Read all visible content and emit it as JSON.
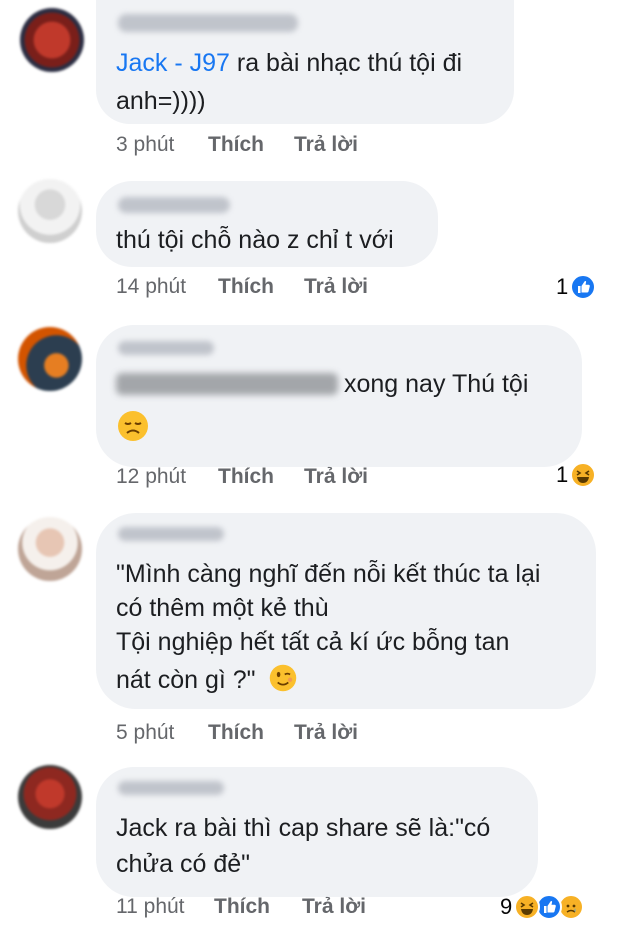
{
  "comments": [
    {
      "mention": "Jack - J97",
      "text_after_mention": " ra bài nhạc thú tội đi",
      "line2": "anh=))))",
      "time": "3 phút",
      "like_label": "Thích",
      "reply_label": "Trả lời"
    },
    {
      "text": "thú tội chỗ nào z chỉ t với",
      "time": "14 phút",
      "like_label": "Thích",
      "reply_label": "Trả lời",
      "reaction_count": "1",
      "reactions": [
        "like-icon"
      ]
    },
    {
      "text_visible": "xong nay Thú tội",
      "emoji": "sad-face-emoji",
      "time": "12 phút",
      "like_label": "Thích",
      "reply_label": "Trả lời",
      "reaction_count": "1",
      "reactions": [
        "haha-icon"
      ]
    },
    {
      "line1": "\"Mình càng nghĩ đến nỗi kết thúc ta lại",
      "line2": "có thêm một kẻ thù",
      "line3": "Tội nghiệp hết tất cả kí ức bỗng tan",
      "line4": "nát còn gì ?\"",
      "emoji": "wink-emoji",
      "time": "5 phút",
      "like_label": "Thích",
      "reply_label": "Trả lời"
    },
    {
      "line1": "Jack ra bài thì cap share sẽ là:\"có",
      "line2": "chửa có đẻ\"",
      "time": "11 phút",
      "like_label": "Thích",
      "reply_label": "Trả lời",
      "reaction_count": "9",
      "reactions": [
        "haha-icon",
        "like-icon",
        "sad-icon"
      ]
    }
  ],
  "colors": {
    "bubble": "#f0f2f5",
    "mention": "#1877f2",
    "meta": "#65676b",
    "like": "#1877f2",
    "haha": "#f7b125"
  }
}
